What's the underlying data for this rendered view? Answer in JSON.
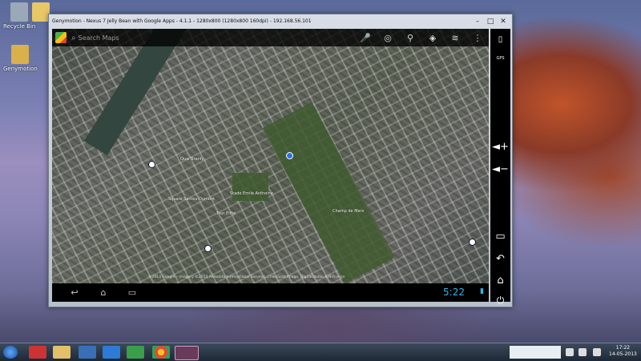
{
  "window": {
    "title": "Genymotion - Nexus 7 Jelly Bean with Google Apps - 4.1.1 - 1280x800 (1280x800 160dpi) - 192.168.56.101",
    "minimize": "–",
    "maximize": "□",
    "close": "✕"
  },
  "desktop": {
    "icons": [
      {
        "label": "Recycle Bin",
        "icon": "recycle-bin-icon",
        "color": "#9aa8b8"
      },
      {
        "label": "",
        "icon": "folder-icon",
        "color": "#e8c766"
      },
      {
        "label": "Genymotion",
        "icon": "folder-icon",
        "color": "#d9b04a"
      }
    ]
  },
  "maps": {
    "search_placeholder": "Search Maps",
    "toolbar_icons": [
      "mic-icon",
      "my-location-icon",
      "places-icon",
      "directions-icon",
      "layers-icon",
      "overflow-menu-icon"
    ],
    "labels": [
      {
        "text": "Square Santos-Dumont"
      },
      {
        "text": "Stade Emile Anthoine"
      },
      {
        "text": "Champ de Mars"
      },
      {
        "text": "Tour Eiffel"
      },
      {
        "text": "Quai Branly"
      }
    ],
    "copyright": "©2013 Google – Imagery ©2013 Aerodata International Surveys, Cnes/Spot Image, DigitalGlobe, IGN France"
  },
  "android": {
    "clock": "5:22",
    "nav_icons": [
      "back-icon",
      "home-icon",
      "recent-apps-icon"
    ]
  },
  "genymotion_sidebar": {
    "icons": [
      "battery-icon",
      "gps-icon",
      "volume-up-icon",
      "volume-down-icon",
      "rotate-icon",
      "back-icon",
      "home-icon",
      "power-icon"
    ],
    "gps_label": "GPS"
  },
  "taskbar": {
    "time": "17:22",
    "date": "14-05-2013"
  }
}
